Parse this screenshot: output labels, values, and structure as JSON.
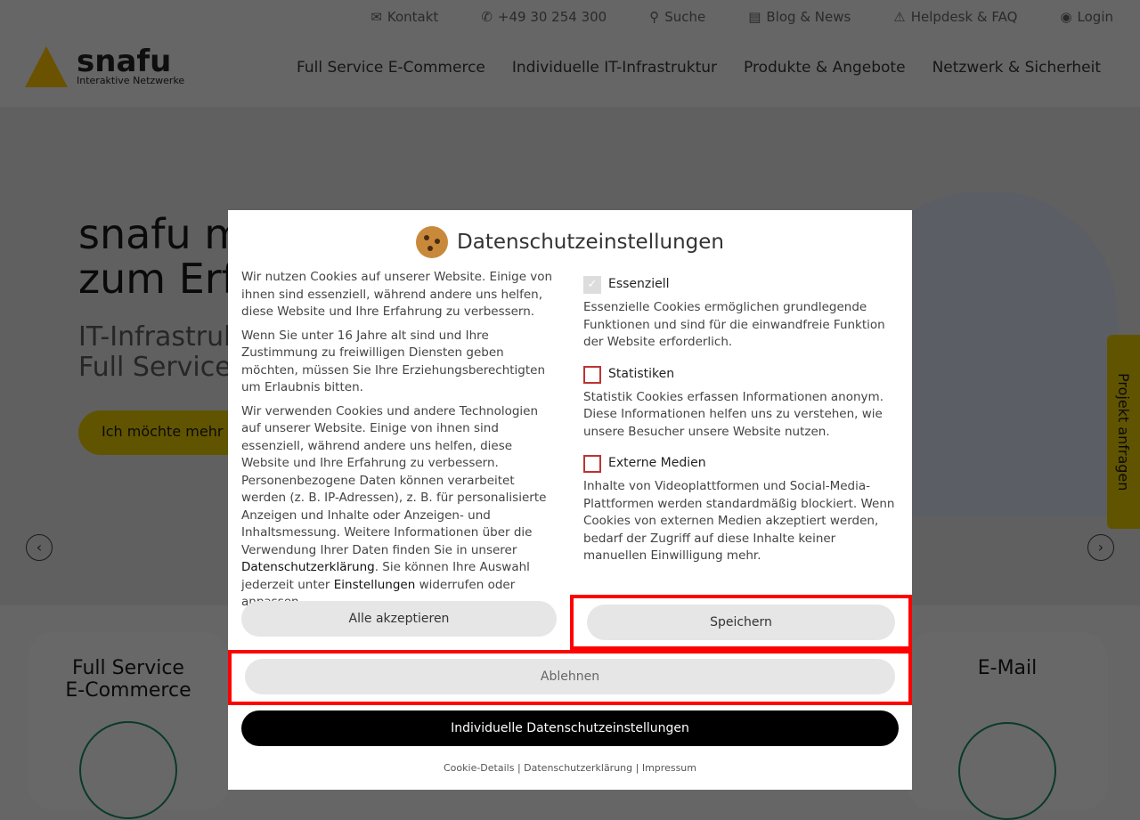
{
  "topbar": [
    {
      "icon": "mail-icon",
      "glyph": "✉",
      "label": "Kontakt"
    },
    {
      "icon": "phone-icon",
      "glyph": "✆",
      "label": "+49 30 254 300"
    },
    {
      "icon": "search-icon",
      "glyph": "⚲",
      "label": "Suche"
    },
    {
      "icon": "news-icon",
      "glyph": "▤",
      "label": "Blog & News"
    },
    {
      "icon": "warning-icon",
      "glyph": "⚠",
      "label": "Helpdesk & FAQ"
    },
    {
      "icon": "user-icon",
      "glyph": "◉",
      "label": "Login"
    }
  ],
  "logo": {
    "name": "snafu",
    "tagline": "Interaktive Netzwerke"
  },
  "nav": [
    "Full Service E-Commerce",
    "Individuelle IT-Infrastruktur",
    "Produkte & Angebote",
    "Netzwerk & Sicherheit"
  ],
  "hero": {
    "title_line1": "snafu ma",
    "title_line2": "zum Erfo",
    "subtitle_line1": "IT-Infrastrukt",
    "subtitle_line2": "Full Service E",
    "cta": "Ich möchte mehr er",
    "side_tab": "Projekt anfragen",
    "prev": "‹",
    "next": "›"
  },
  "cards": [
    "Full Service E-Commerce",
    "E-Mail"
  ],
  "modal": {
    "title": "Datenschutzeinstellungen",
    "p1": "Wir nutzen Cookies auf unserer Website. Einige von ihnen sind essenziell, während andere uns helfen, diese Website und Ihre Erfahrung zu verbessern.",
    "p2": "Wenn Sie unter 16 Jahre alt sind und Ihre Zustimmung zu freiwilligen Diensten geben möchten, müssen Sie Ihre Erziehungsberechtigten um Erlaubnis bitten.",
    "p3a": "Wir verwenden Cookies und andere Technologien auf unserer Website. Einige von ihnen sind essenziell, während andere uns helfen, diese Website und Ihre Erfahrung zu verbessern. Personenbezogene Daten können verarbeitet werden (z. B. IP-Adressen), z. B. für personalisierte Anzeigen und Inhalte oder Anzeigen- und Inhaltsmessung. Weitere Informationen über die Verwendung Ihrer Daten finden Sie in unserer ",
    "p3link1": "Datenschutzerklärung",
    "p3b": ". Sie können Ihre Auswahl jederzeit unter ",
    "p3link2": "Einstellungen",
    "p3c": " widerrufen oder anpassen.",
    "options": [
      {
        "label": "Essenziell",
        "checked": true,
        "disabled": true,
        "desc": "Essenzielle Cookies ermöglichen grundlegende Funktionen und sind für die einwandfreie Funktion der Website erforderlich."
      },
      {
        "label": "Statistiken",
        "checked": false,
        "desc": "Statistik Cookies erfassen Informationen anonym. Diese Informationen helfen uns zu verstehen, wie unsere Besucher unsere Website nutzen."
      },
      {
        "label": "Externe Medien",
        "checked": false,
        "desc": "Inhalte von Videoplattformen und Social-Media-Plattformen werden standardmäßig blockiert. Wenn Cookies von externen Medien akzeptiert werden, bedarf der Zugriff auf diese Inhalte keiner manuellen Einwilligung mehr."
      }
    ],
    "accept_all": "Alle akzeptieren",
    "save": "Speichern",
    "reject": "Ablehnen",
    "individual": "Individuelle Datenschutzeinstellungen",
    "footer_links": [
      "Cookie-Details",
      "Datenschutzerklärung",
      "Impressum"
    ],
    "check_glyph": "✓"
  },
  "colors": {
    "accent": "#f0d200",
    "highlight": "#ff0000",
    "primary_button": "#000000"
  }
}
